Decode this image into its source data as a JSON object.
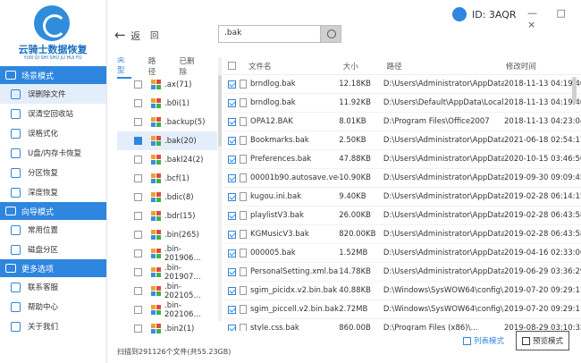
{
  "brand": {
    "name": "云骑士数据恢复",
    "sub": "YUN QI SHI SHU JU HUI FU"
  },
  "sidebar": {
    "sections": [
      {
        "title": "场景模式",
        "items": [
          {
            "label": "误删除文件",
            "icon": "file-delete-icon",
            "active": true
          },
          {
            "label": "误清空回收站",
            "icon": "recycle-bin-icon"
          },
          {
            "label": "误格式化",
            "icon": "format-icon"
          },
          {
            "label": "U盘/内存卡恢复",
            "icon": "usb-icon"
          },
          {
            "label": "分区恢复",
            "icon": "partition-icon"
          },
          {
            "label": "深度恢复",
            "icon": "deep-scan-icon"
          }
        ]
      },
      {
        "title": "向导模式",
        "items": [
          {
            "label": "常用位置",
            "icon": "location-icon"
          },
          {
            "label": "磁盘分区",
            "icon": "disk-icon"
          }
        ]
      },
      {
        "title": "更多选项",
        "items": [
          {
            "label": "联系客服",
            "icon": "support-icon"
          },
          {
            "label": "帮助中心",
            "icon": "help-icon"
          },
          {
            "label": "关于我们",
            "icon": "about-icon"
          }
        ]
      }
    ]
  },
  "toolbar": {
    "back": "返",
    "back2": "回",
    "search_value": ".bak"
  },
  "user": {
    "id_label": "ID: 3AQR"
  },
  "window_controls": "— □ ×",
  "tree": {
    "tabs": [
      "类型",
      "路径",
      "已删除"
    ],
    "rows": [
      {
        "label": ".ax(71)",
        "state": "off"
      },
      {
        "label": ".b0i(1)",
        "state": "off"
      },
      {
        "label": ".backup(5)",
        "state": "off"
      },
      {
        "label": ".bak(20)",
        "state": "full",
        "selected": true
      },
      {
        "label": ".bakl24(2)",
        "state": "off"
      },
      {
        "label": ".bcf(1)",
        "state": "off"
      },
      {
        "label": ".bdic(8)",
        "state": "off"
      },
      {
        "label": ".bdr(15)",
        "state": "off"
      },
      {
        "label": ".bin(265)",
        "state": "off"
      },
      {
        "label": ".bin-201906...",
        "state": "off"
      },
      {
        "label": ".bin-201907...",
        "state": "off"
      },
      {
        "label": ".bin-202105...",
        "state": "off"
      },
      {
        "label": ".bin-202106...",
        "state": "off"
      },
      {
        "label": ".bin2(1)",
        "state": "off"
      }
    ]
  },
  "grid": {
    "headers": {
      "name": "文件名",
      "size": "大小",
      "path": "路径",
      "date": "修改时间"
    },
    "rows": [
      {
        "name": "brndlog.bak",
        "size": "12.18KB",
        "path": "D:\\Users\\Administrator\\AppData...",
        "date": "2018-11-13 04:19:40"
      },
      {
        "name": "brndlog.bak",
        "size": "11.92KB",
        "path": "D:\\Users\\Default\\AppData\\Local...",
        "date": "2018-11-13 04:19:40"
      },
      {
        "name": "OPA12.BAK",
        "size": "8.01KB",
        "path": "D:\\Program Files\\Office2007",
        "date": "2018-11-13 04:23:04"
      },
      {
        "name": "Bookmarks.bak",
        "size": "2.50KB",
        "path": "D:\\Users\\Administrator\\AppData...",
        "date": "2021-06-18 02:54:17"
      },
      {
        "name": "Preferences.bak",
        "size": "47.88KB",
        "path": "D:\\Users\\Administrator\\AppData...",
        "date": "2020-10-15 03:46:50"
      },
      {
        "name": "00001b90.autosave.veg...",
        "size": "10.90KB",
        "path": "D:\\Users\\Administrator\\AppData...",
        "date": "2019-09-30 09:09:45"
      },
      {
        "name": "kugou.ini.bak",
        "size": "9.40KB",
        "path": "D:\\Users\\Administrator\\AppData...",
        "date": "2019-02-28 06:14:15"
      },
      {
        "name": "playlistV3.bak",
        "size": "26.00KB",
        "path": "D:\\Users\\Administrator\\AppData...",
        "date": "2019-02-28 06:43:58"
      },
      {
        "name": "KGMusicV3.bak",
        "size": "820.00KB",
        "path": "D:\\Users\\Administrator\\AppData...",
        "date": "2019-02-28 06:43:58"
      },
      {
        "name": "000005.bak",
        "size": "1.52MB",
        "path": "D:\\Users\\Administrator\\AppData...",
        "date": "2019-04-16 02:33:06"
      },
      {
        "name": "PersonalSetting.xml.bak",
        "size": "14.78KB",
        "path": "D:\\Users\\Administrator\\AppData...",
        "date": "2019-06-29 03:36:29"
      },
      {
        "name": "sgim_picidx.v2.bin.bak",
        "size": "40.88KB",
        "path": "D:\\Windows\\SysWOW64\\config\\...",
        "date": "2019-07-20 09:29:11"
      },
      {
        "name": "sgim_piccell.v2.bin.bak",
        "size": "2.72MB",
        "path": "D:\\Windows\\SysWOW64\\config\\...",
        "date": "2019-07-20 09:29:11"
      },
      {
        "name": "style.css.bak",
        "size": "860.00B",
        "path": "D:\\Program Files (x86)\\...",
        "date": "2019-08-29 03:10:32"
      }
    ]
  },
  "footer": {
    "status": "扫描到291126个文件(共55.23GB)",
    "list_view": "列表模式",
    "preview_view": "预览模式"
  },
  "colors": {
    "accent": "#2e86de",
    "selected_bg": "#e4eefb"
  }
}
